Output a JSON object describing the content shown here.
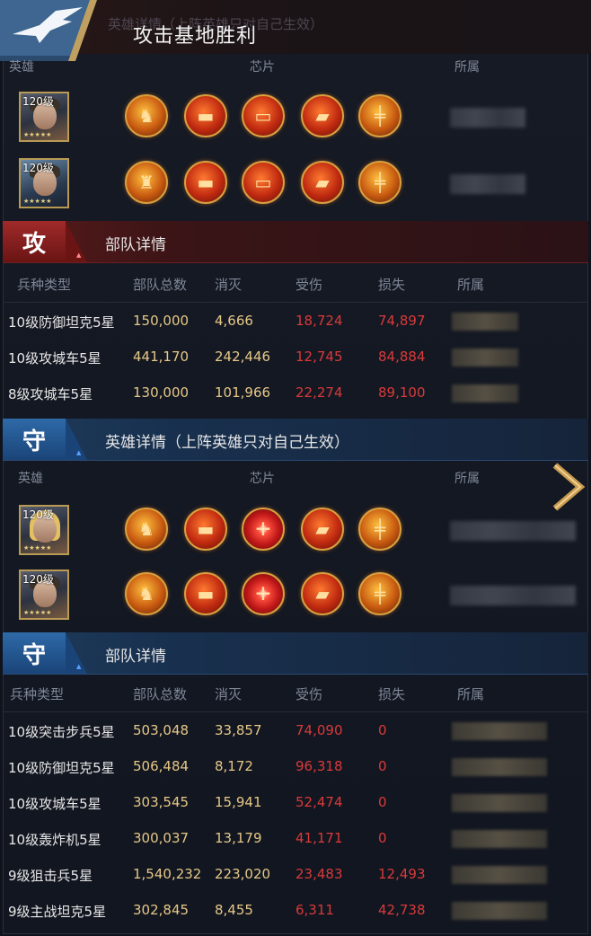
{
  "header": {
    "title": "攻击基地胜利",
    "ghost_text": "英雄详情（上阵英雄只对自己生效）"
  },
  "attack_heroes": {
    "columns": [
      "英雄",
      "芯片",
      "所属"
    ],
    "rows": [
      {
        "level": "120级",
        "chips": [
          "soldier-chip",
          "tank-chip",
          "tank-chip",
          "truck-chip",
          "gun-chip"
        ]
      },
      {
        "level": "120级",
        "chips": [
          "soldier-chip",
          "tank-chip",
          "tank-chip",
          "truck-chip",
          "gun-chip"
        ]
      }
    ]
  },
  "attack_troops": {
    "badge": "攻",
    "title": "部队详情",
    "columns": [
      "兵种类型",
      "部队总数",
      "消灭",
      "受伤",
      "损失",
      "所属"
    ],
    "rows": [
      {
        "type": "10级防御坦克5星",
        "total": "150,000",
        "kill": "4,666",
        "damaged": "18,724",
        "loss": "74,897"
      },
      {
        "type": "10级攻城车5星",
        "total": "441,170",
        "kill": "242,446",
        "damaged": "12,745",
        "loss": "84,884"
      },
      {
        "type": "8级攻城车5星",
        "total": "130,000",
        "kill": "101,966",
        "damaged": "22,274",
        "loss": "89,100"
      }
    ]
  },
  "defense_heroes": {
    "badge": "守",
    "title": "英雄详情（上阵英雄只对自己生效）",
    "columns": [
      "英雄",
      "芯片",
      "所属"
    ],
    "rows": [
      {
        "level": "120级",
        "chips": [
          "soldier-chip",
          "tank-chip",
          "target-chip",
          "truck-chip",
          "gun-chip"
        ]
      },
      {
        "level": "120级",
        "chips": [
          "soldier-chip",
          "tank-chip",
          "target-chip",
          "truck-chip",
          "gun-chip"
        ]
      }
    ]
  },
  "defense_troops": {
    "badge": "守",
    "title": "部队详情",
    "columns": [
      "兵种类型",
      "部队总数",
      "消灭",
      "受伤",
      "损失",
      "所属"
    ],
    "rows": [
      {
        "type": "10级突击步兵5星",
        "total": "503,048",
        "kill": "33,857",
        "damaged": "74,090",
        "loss": "0"
      },
      {
        "type": "10级防御坦克5星",
        "total": "506,484",
        "kill": "8,172",
        "damaged": "96,318",
        "loss": "0"
      },
      {
        "type": "10级攻城车5星",
        "total": "303,545",
        "kill": "15,941",
        "damaged": "52,474",
        "loss": "0"
      },
      {
        "type": "10级轰炸机5星",
        "total": "300,037",
        "kill": "13,179",
        "damaged": "41,171",
        "loss": "0"
      },
      {
        "type": "9级狙击兵5星",
        "total": "1,540,232",
        "kill": "223,020",
        "damaged": "23,483",
        "loss": "12,493"
      },
      {
        "type": "9级主战坦克5星",
        "total": "302,845",
        "kill": "8,455",
        "damaged": "6,311",
        "loss": "42,738"
      }
    ]
  },
  "colors": {
    "damage": "#d83a3a",
    "value": "#e6c888",
    "attack_banner": "#5a1a1a",
    "defense_banner": "#1e3a5c"
  }
}
